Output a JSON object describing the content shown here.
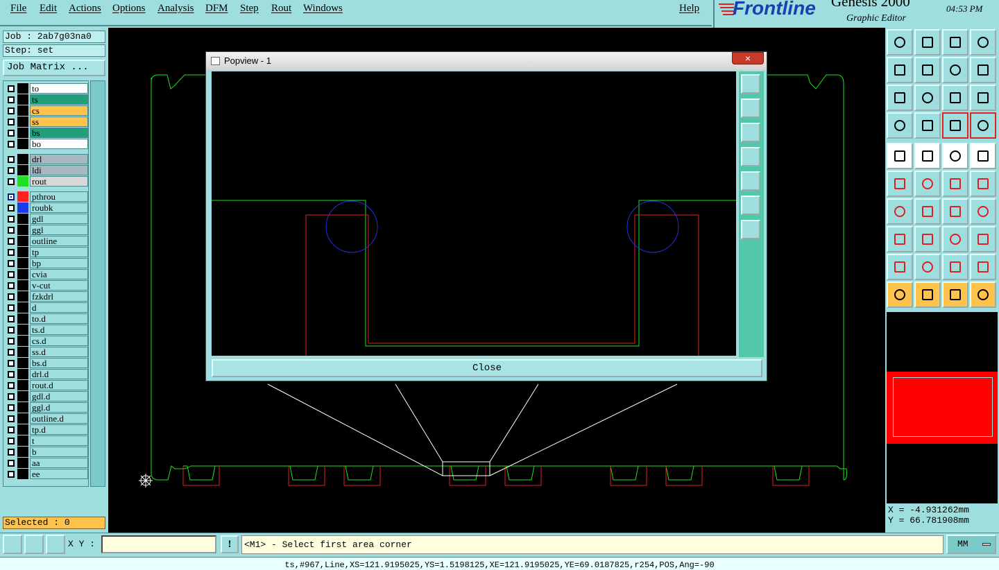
{
  "menu": {
    "items": [
      "File",
      "Edit",
      "Actions",
      "Options",
      "Analysis",
      "DFM",
      "Step",
      "Rout",
      "Windows"
    ],
    "help": "Help"
  },
  "brand": {
    "logo": "Frontline",
    "product": "Genesis 2000",
    "subtitle": "Graphic Editor",
    "time": "04:53 PM"
  },
  "job": {
    "job_line": "Job : 2ab7g03na0",
    "step_line": "Step: set",
    "matrix_button": "Job Matrix ..."
  },
  "layers": [
    {
      "name": "to",
      "color": "#ffffff"
    },
    {
      "name": "ts",
      "color": "#1fa07a"
    },
    {
      "name": "cs",
      "color": "#ffc24a"
    },
    {
      "name": "ss",
      "color": "#ffc24a"
    },
    {
      "name": "bs",
      "color": "#1fa07a"
    },
    {
      "name": "bo",
      "color": "#ffffff"
    },
    {
      "name": "drl",
      "color": "#a8b8c0"
    },
    {
      "name": "ldi",
      "color": "#a8b8c0"
    },
    {
      "name": "rout",
      "color": "#d8d8d8",
      "swatch": "#20e020"
    },
    {
      "name": "pthrou",
      "color": "#9fdede",
      "swatch": "#ff2020",
      "cbcolor": "#0a1a8a"
    },
    {
      "name": "roubk",
      "color": "#9fdede",
      "swatch": "#1a3af0"
    },
    {
      "name": "gdl",
      "color": "#9fdede"
    },
    {
      "name": "ggl",
      "color": "#9fdede"
    },
    {
      "name": "outline",
      "color": "#9fdede"
    },
    {
      "name": "tp",
      "color": "#9fdede"
    },
    {
      "name": "bp",
      "color": "#9fdede"
    },
    {
      "name": "cvia",
      "color": "#9fdede"
    },
    {
      "name": "v-cut",
      "color": "#9fdede"
    },
    {
      "name": "fzkdrl",
      "color": "#9fdede"
    },
    {
      "name": "d",
      "color": "#9fdede"
    },
    {
      "name": "to.d",
      "color": "#9fdede"
    },
    {
      "name": "ts.d",
      "color": "#9fdede"
    },
    {
      "name": "cs.d",
      "color": "#9fdede"
    },
    {
      "name": "ss.d",
      "color": "#9fdede"
    },
    {
      "name": "bs.d",
      "color": "#9fdede"
    },
    {
      "name": "drl.d",
      "color": "#9fdede"
    },
    {
      "name": "rout.d",
      "color": "#9fdede"
    },
    {
      "name": "gdl.d",
      "color": "#9fdede"
    },
    {
      "name": "ggl.d",
      "color": "#9fdede"
    },
    {
      "name": "outline.d",
      "color": "#9fdede"
    },
    {
      "name": "tp.d",
      "color": "#9fdede"
    },
    {
      "name": "t",
      "color": "#9fdede"
    },
    {
      "name": "b",
      "color": "#9fdede"
    },
    {
      "name": "aa",
      "color": "#9fdede"
    },
    {
      "name": "ee",
      "color": "#9fdede"
    }
  ],
  "selected": "Selected : 0",
  "popup": {
    "title": "Popview - 1",
    "close_x": "×",
    "close_button": "Close"
  },
  "coords": {
    "x": "X = -4.931262mm",
    "y": "Y = 66.781908mm"
  },
  "bottom": {
    "xy_label": "X Y :",
    "xy_value": "",
    "excl": "!",
    "prompt": "<M1> - Select first area corner",
    "units": "MM"
  },
  "status": "ts,#967,Line,XS=121.9195025,YS=1.5198125,XE=121.9195025,YE=69.0187825,r254,POS,Ang=-90",
  "colors": {
    "panel": "#9fdede",
    "accent_orange": "#ffc24a",
    "board_outline": "#20e020",
    "rout_red": "#e02020",
    "hole_blue": "#2030e0"
  }
}
